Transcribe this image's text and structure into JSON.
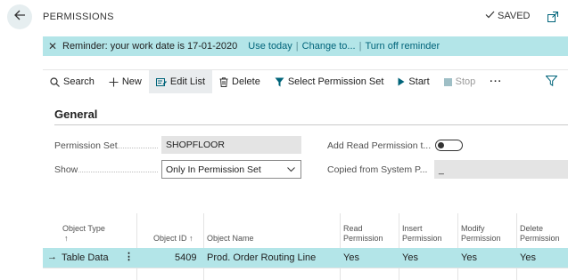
{
  "header": {
    "caption": "PERMISSIONS",
    "saved_label": "SAVED"
  },
  "banner": {
    "message": "Reminder: your work date is 17-01-2020",
    "use_today": "Use today",
    "change_to": "Change to...",
    "turn_off": "Turn off reminder",
    "separator": "|"
  },
  "actions": {
    "search": "Search",
    "new": "New",
    "edit_list": "Edit List",
    "delete": "Delete",
    "select_permission_set": "Select Permission Set",
    "start": "Start",
    "stop": "Stop",
    "more": "···"
  },
  "general": {
    "title": "General",
    "permission_set_label": "Permission Set",
    "permission_set_value": "SHOPFLOOR",
    "show_label": "Show",
    "show_value": "Only In Permission Set",
    "add_read_label": "Add Read Permission t...",
    "add_read_value": false,
    "copied_from_label": "Copied from System P...",
    "copied_from_value": "_"
  },
  "grid": {
    "columns": {
      "object_type": "Object Type",
      "object_type_sort": "↑",
      "object_id": "Object ID ↑",
      "object_name": "Object Name",
      "read_1": "Read",
      "read_2": "Permission",
      "insert_1": "Insert",
      "insert_2": "Permission",
      "modify_1": "Modify",
      "modify_2": "Permission",
      "delete_1": "Delete",
      "delete_2": "Permission"
    },
    "rows": [
      {
        "arrow": "→",
        "object_type": "Table Data",
        "menu": "⋮",
        "object_id": "5409",
        "object_name": "Prod. Order Routing Line",
        "read": "Yes",
        "insert": "Yes",
        "modify": "Yes",
        "delete": "Yes"
      }
    ]
  },
  "colors": {
    "accent": "#00647a",
    "highlight": "#b3e5e8"
  }
}
